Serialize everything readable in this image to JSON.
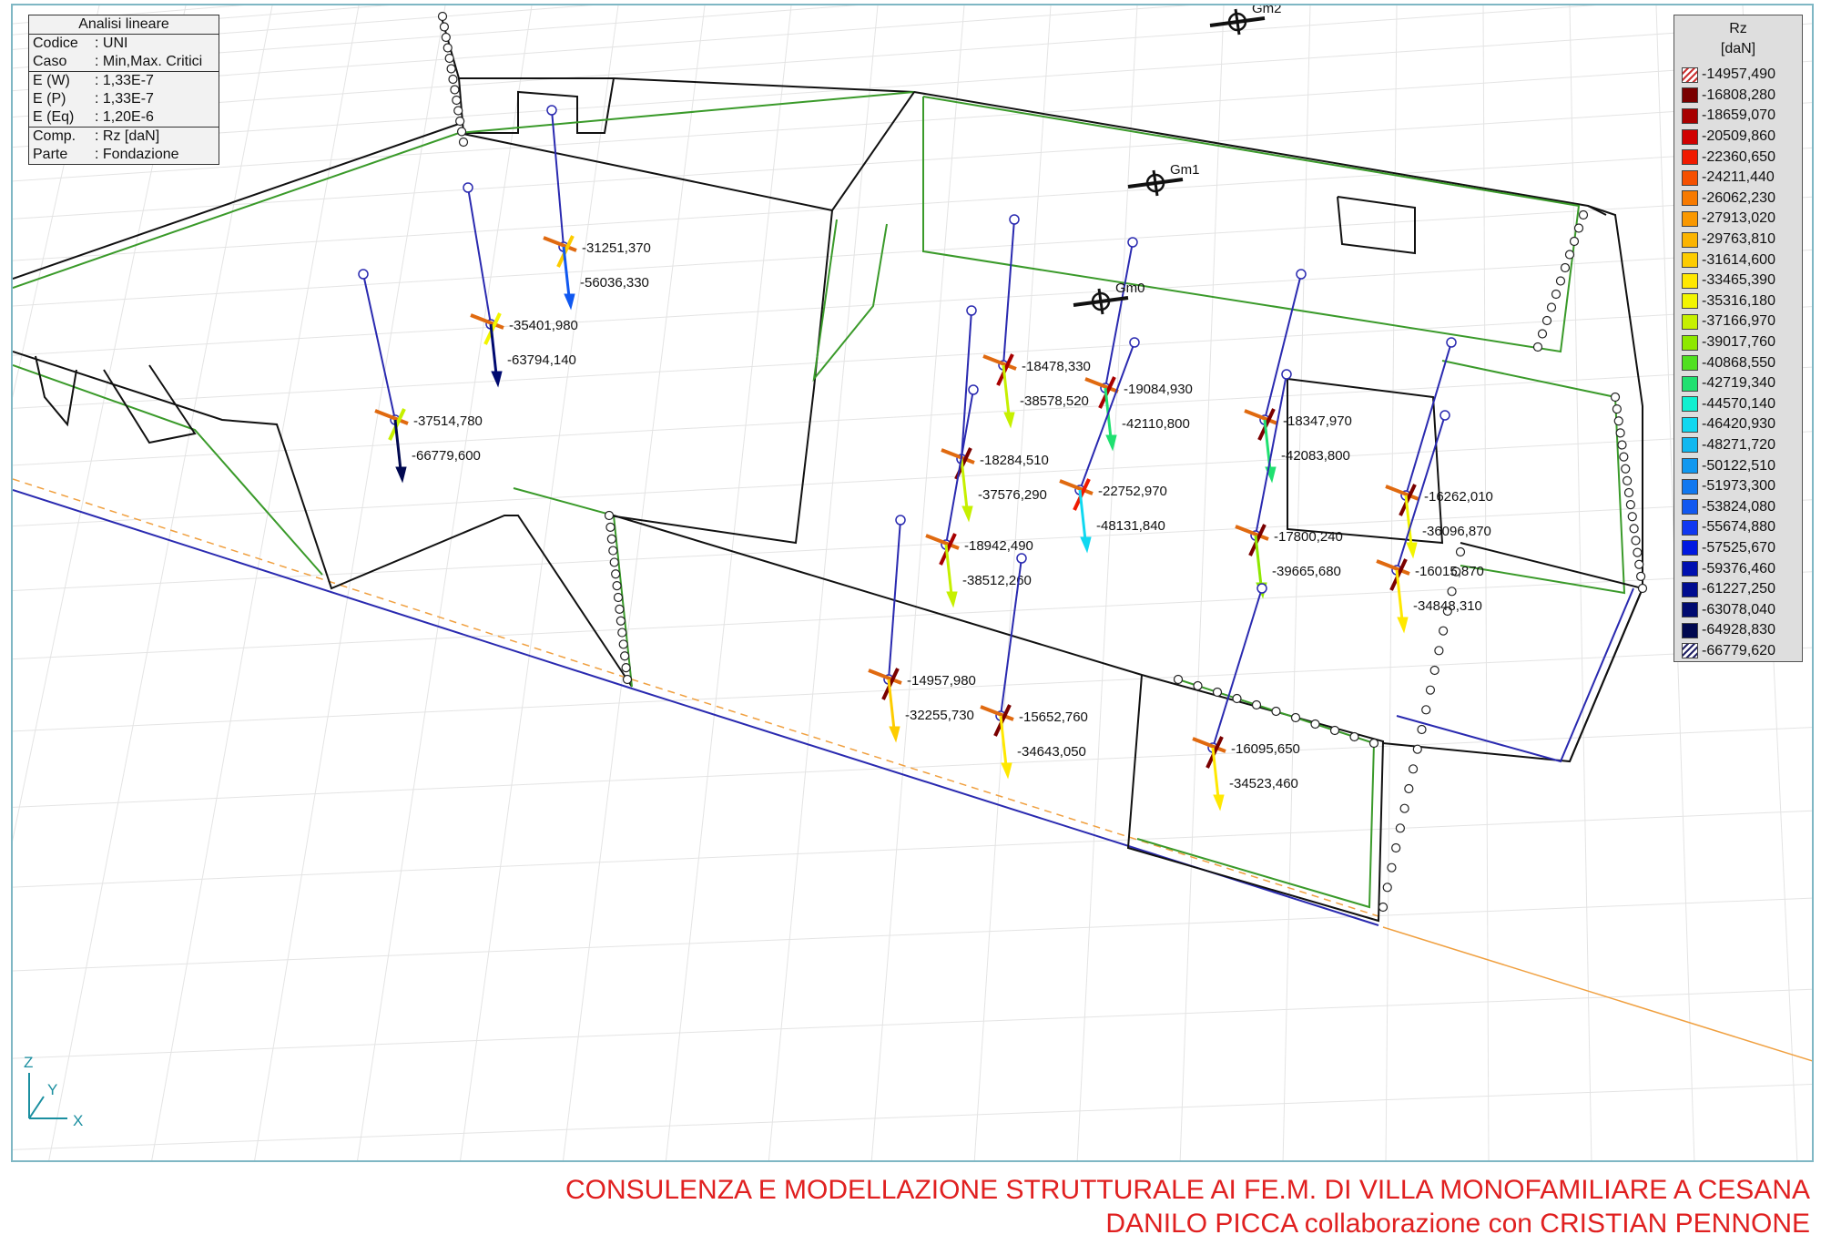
{
  "info": {
    "title": "Analisi lineare",
    "rows": [
      {
        "k": "Codice",
        "v": ": UNI"
      },
      {
        "k": "Caso",
        "v": ": Min,Max. Critici"
      },
      {
        "k": "E (W)",
        "v": ": 1,33E-7"
      },
      {
        "k": "E (P)",
        "v": ": 1,33E-7"
      },
      {
        "k": "E (Eq)",
        "v": ": 1,20E-6"
      },
      {
        "k": "Comp.",
        "v": ": Rz [daN]"
      },
      {
        "k": "Parte",
        "v": ": Fondazione"
      }
    ]
  },
  "legend": {
    "title": "Rz",
    "unit": "[daN]",
    "entries": [
      {
        "label": "-14957,490",
        "color": "hatch-red"
      },
      {
        "label": "-16808,280",
        "color": "#7a0000"
      },
      {
        "label": "-18659,070",
        "color": "#a80000"
      },
      {
        "label": "-20509,860",
        "color": "#d00000"
      },
      {
        "label": "-22360,650",
        "color": "#f01a00"
      },
      {
        "label": "-24211,440",
        "color": "#f55000"
      },
      {
        "label": "-26062,230",
        "color": "#f77a00"
      },
      {
        "label": "-27913,020",
        "color": "#f99800"
      },
      {
        "label": "-29763,810",
        "color": "#fbb400"
      },
      {
        "label": "-31614,600",
        "color": "#fdcc00"
      },
      {
        "label": "-33465,390",
        "color": "#ffe800"
      },
      {
        "label": "-35316,180",
        "color": "#f2f500"
      },
      {
        "label": "-37166,970",
        "color": "#c6f000"
      },
      {
        "label": "-39017,760",
        "color": "#8ee800"
      },
      {
        "label": "-40868,550",
        "color": "#50e020"
      },
      {
        "label": "-42719,340",
        "color": "#20e070"
      },
      {
        "label": "-44570,140",
        "color": "#10f0d0"
      },
      {
        "label": "-46420,930",
        "color": "#10d8f0"
      },
      {
        "label": "-48271,720",
        "color": "#10b8f0"
      },
      {
        "label": "-50122,510",
        "color": "#1098f0"
      },
      {
        "label": "-51973,300",
        "color": "#1078f0"
      },
      {
        "label": "-53824,080",
        "color": "#1058f0"
      },
      {
        "label": "-55674,880",
        "color": "#1038f0"
      },
      {
        "label": "-57525,670",
        "color": "#0018e0"
      },
      {
        "label": "-59376,460",
        "color": "#0010b0"
      },
      {
        "label": "-61227,250",
        "color": "#000c90"
      },
      {
        "label": "-63078,040",
        "color": "#000a70"
      },
      {
        "label": "-64928,830",
        "color": "#000850"
      },
      {
        "label": "-66779,620",
        "color": "hatch-blue"
      }
    ]
  },
  "pillars": [
    {
      "v1": "-31251,370",
      "v2": "-56036,330",
      "c1": "#fdcc00",
      "c2": "#1058f0"
    },
    {
      "v1": "-35401,980",
      "v2": "-63794,140",
      "c1": "#f2f500",
      "c2": "#000a70"
    },
    {
      "v1": "-37514,780",
      "v2": "-66779,600",
      "c1": "#c6f000",
      "c2": "#000850"
    },
    {
      "v1": "-18478,330",
      "v2": "-38578,520",
      "c1": "#a80000",
      "c2": "#c6f000"
    },
    {
      "v1": "-19084,930",
      "v2": "-42110,800",
      "c1": "#a80000",
      "c2": "#20e070"
    },
    {
      "v1": "-18347,970",
      "v2": "-42083,800",
      "c1": "#7a0000",
      "c2": "#20e070"
    },
    {
      "v1": "-18284,510",
      "v2": "-37576,290",
      "c1": "#7a0000",
      "c2": "#c6f000"
    },
    {
      "v1": "-22752,970",
      "v2": "-48131,840",
      "c1": "#f01a00",
      "c2": "#10d8f0"
    },
    {
      "v1": "-16262,010",
      "v2": "-36096,870",
      "c1": "#7a0000",
      "c2": "#f2f500"
    },
    {
      "v1": "-18942,490",
      "v2": "-38512,260",
      "c1": "#a80000",
      "c2": "#c6f000"
    },
    {
      "v1": "-17800,240",
      "v2": "-39665,680",
      "c1": "#7a0000",
      "c2": "#8ee800"
    },
    {
      "v1": "-16015,870",
      "v2": "-34848,310",
      "c1": "#7a0000",
      "c2": "#ffe800"
    },
    {
      "v1": "-14957,980",
      "v2": "-32255,730",
      "c1": "#7a0000",
      "c2": "#fdcc00"
    },
    {
      "v1": "-15652,760",
      "v2": "-34643,050",
      "c1": "#7a0000",
      "c2": "#ffe800"
    },
    {
      "v1": "-16095,650",
      "v2": "-34523,460",
      "c1": "#7a0000",
      "c2": "#ffe800"
    }
  ],
  "markers": [
    "Gm2",
    "Gm1",
    "Gm0"
  ],
  "axes": {
    "z": "Z",
    "y": "Y",
    "x": "X"
  },
  "caption": {
    "line1": "CONSULENZA E MODELLAZIONE STRUTTURALE AI FE.M. DI VILLA MONOFAMILIARE A CESANA",
    "line2": "DANILO PICCA collaborazione con CRISTIAN PENNONE"
  }
}
